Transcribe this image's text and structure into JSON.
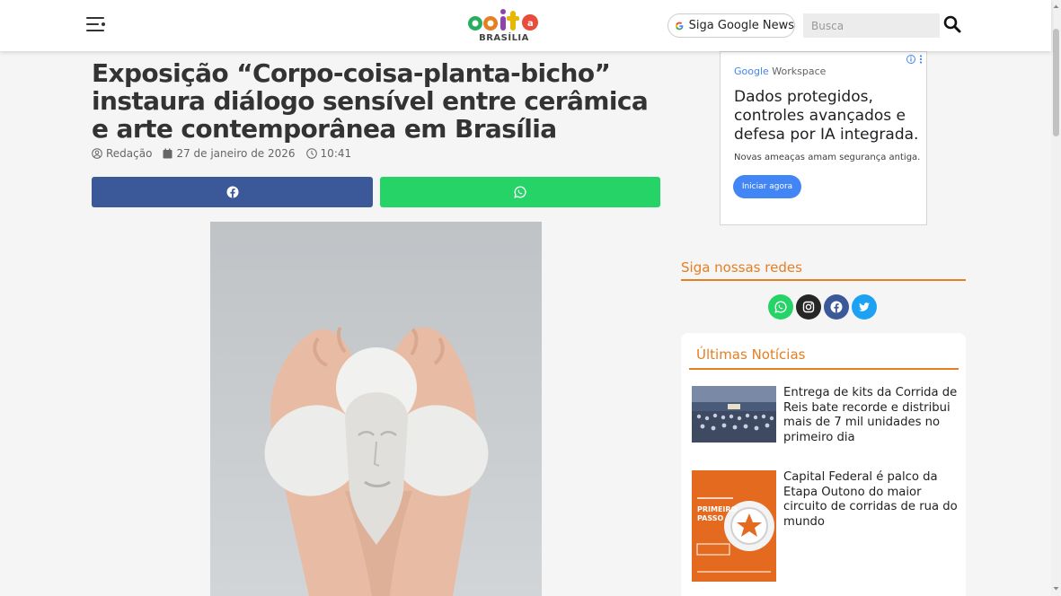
{
  "header": {
    "logo_text": "agita",
    "logo_sub": "BRASÍLIA",
    "google_news_label": "Siga Google News",
    "search_placeholder": "Busca"
  },
  "article": {
    "title": "Exposição “Corpo-coisa-planta-bicho” instaura diálogo sensível entre cerâmica e arte contemporânea em Brasília",
    "author": "Redação",
    "date": "27 de janeiro de 2026",
    "time": "10:41"
  },
  "ad": {
    "brand_google": "Google",
    "brand_product": "Workspace",
    "headline": "Dados protegidos, controles avançados e defesa por IA integrada.",
    "subtext": "Novas ameaças amam segurança antiga.",
    "cta": "Iniciar agora"
  },
  "social": {
    "title": "Siga nossas redes"
  },
  "latest": {
    "title": "Últimas Notícias",
    "items": [
      {
        "headline": "Entrega de kits da Corrida de Reis bate recorde e distribui mais de 7 mil unidades no primeiro dia"
      },
      {
        "headline": "Capital Federal é palco da Etapa Outono do maior circuito de corridas de rua do mundo"
      }
    ],
    "thumb2_text": "PRIMEIRO PASSO"
  },
  "colors": {
    "accent": "#e67e22",
    "facebook": "#3b5998",
    "whatsapp": "#25d366",
    "instagram": "#262626",
    "twitter": "#1da1f2"
  }
}
